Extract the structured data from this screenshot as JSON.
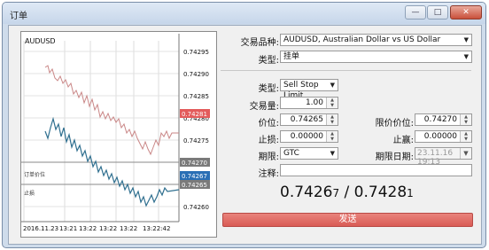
{
  "window": {
    "title": "订单",
    "buttons": {
      "minimize": "—",
      "maximize": "□",
      "close": "✕"
    }
  },
  "chart": {
    "symbol": "AUDUSD",
    "time_labels": [
      "2016.11.23",
      "13:21",
      "13:22",
      "13:22",
      "13:22",
      "13:22:42"
    ],
    "price_labels": [
      "0.74295",
      "0.74290",
      "0.74285",
      "0.74280",
      "0.74275",
      "0.74270",
      "0.74265",
      "0.74260"
    ],
    "price_tags": [
      {
        "text": "0.74281",
        "color": "#e35b5b"
      },
      {
        "text": "0.74270",
        "color": "#7a7a7a"
      },
      {
        "text": "0.74267",
        "color": "#2a6fb5"
      },
      {
        "text": "0.74265",
        "color": "#7a7a7a"
      }
    ],
    "line_labels": {
      "order": "订单价位",
      "sl": "止损"
    },
    "ask_color": "#c98686",
    "bid_color": "#2f6f8f"
  },
  "form": {
    "symbol_label": "交易品种:",
    "symbol_value": "AUDUSD, Australian Dollar vs US Dollar",
    "type_label": "类型:",
    "type_value": "挂单",
    "order_type_label": "类型:",
    "order_type_value": "Sell Stop Limit",
    "volume_label": "交易量:",
    "volume_value": "1.00",
    "price_label": "价位:",
    "price_value": "0.74265",
    "limit_price_label": "限价价位:",
    "limit_price_value": "0.74270",
    "sl_label": "止损:",
    "sl_value": "0.00000",
    "tp_label": "止赢:",
    "tp_value": "0.00000",
    "expiry_label": "期限:",
    "expiry_value": "GTC",
    "expiry_date_label": "期限日期:",
    "expiry_date_value": "23.11.16 19:13",
    "comment_label": "注释:",
    "comment_value": ""
  },
  "quote": {
    "bid_main": "0.7426",
    "bid_small": "7",
    "sep": " / ",
    "ask_main": "0.7428",
    "ask_small": "1"
  },
  "send_label": "发送"
}
